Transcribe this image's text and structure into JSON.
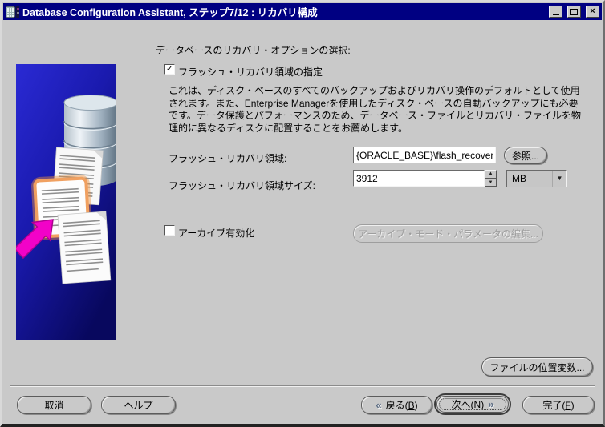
{
  "window": {
    "title": "Database Configuration Assistant, ステップ7/12 : リカバリ構成"
  },
  "icons": {
    "title_icon": "dbca-app-icon",
    "minimize": "minimize-icon",
    "maximize": "maximize-icon",
    "close": "close-icon"
  },
  "glyphs": {
    "close_char": "×",
    "check": "✓",
    "spin_up": "▲",
    "spin_down": "▼",
    "combo_down": "▼",
    "back_chevron": "«",
    "next_chevron": "»"
  },
  "main": {
    "heading": "データベースのリカバリ・オプションの選択:",
    "flash_recovery": {
      "checkbox_label": "フラッシュ・リカバリ領域の指定",
      "checked": true,
      "description": "これは、ディスク・ベースのすべてのバックアップおよびリカバリ操作のデフォルトとして使用\nされます。また、Enterprise Managerを使用したディスク・ベースの自動バックアップにも必要\nです。データ保護とパフォーマンスのため、データベース・ファイルとリカバリ・ファイルを物\n理的に異なるディスクに配置することをお薦めします。",
      "area_label": "フラッシュ・リカバリ領域:",
      "area_value": "{ORACLE_BASE}\\flash_recover",
      "browse_label": "参照...",
      "size_label": "フラッシュ・リカバリ領域サイズ:",
      "size_value": "3912",
      "size_unit": "MB"
    },
    "archive": {
      "checkbox_label": "アーカイブ有効化",
      "checked": false,
      "check_glyph": "",
      "edit_params_label": "アーカイブ・モード・パラメータの編集..."
    },
    "file_location_vars_label": "ファイルの位置変数..."
  },
  "footer": {
    "cancel_label": "取消",
    "help_label": "ヘルプ",
    "back": {
      "pre": "戻る(",
      "mnemonic": "B",
      "post": ")"
    },
    "next": {
      "pre": "次へ(",
      "mnemonic": "N",
      "post": ")"
    },
    "finish": {
      "pre": "完了(",
      "mnemonic": "F",
      "post": ")"
    }
  },
  "colors": {
    "titlebar": "#000082",
    "dialog_gray": "#c9c9c9",
    "panel_blue_top": "#2a2ad4",
    "panel_blue_bottom": "#08085e",
    "arrow_magenta": "#f202c8"
  }
}
